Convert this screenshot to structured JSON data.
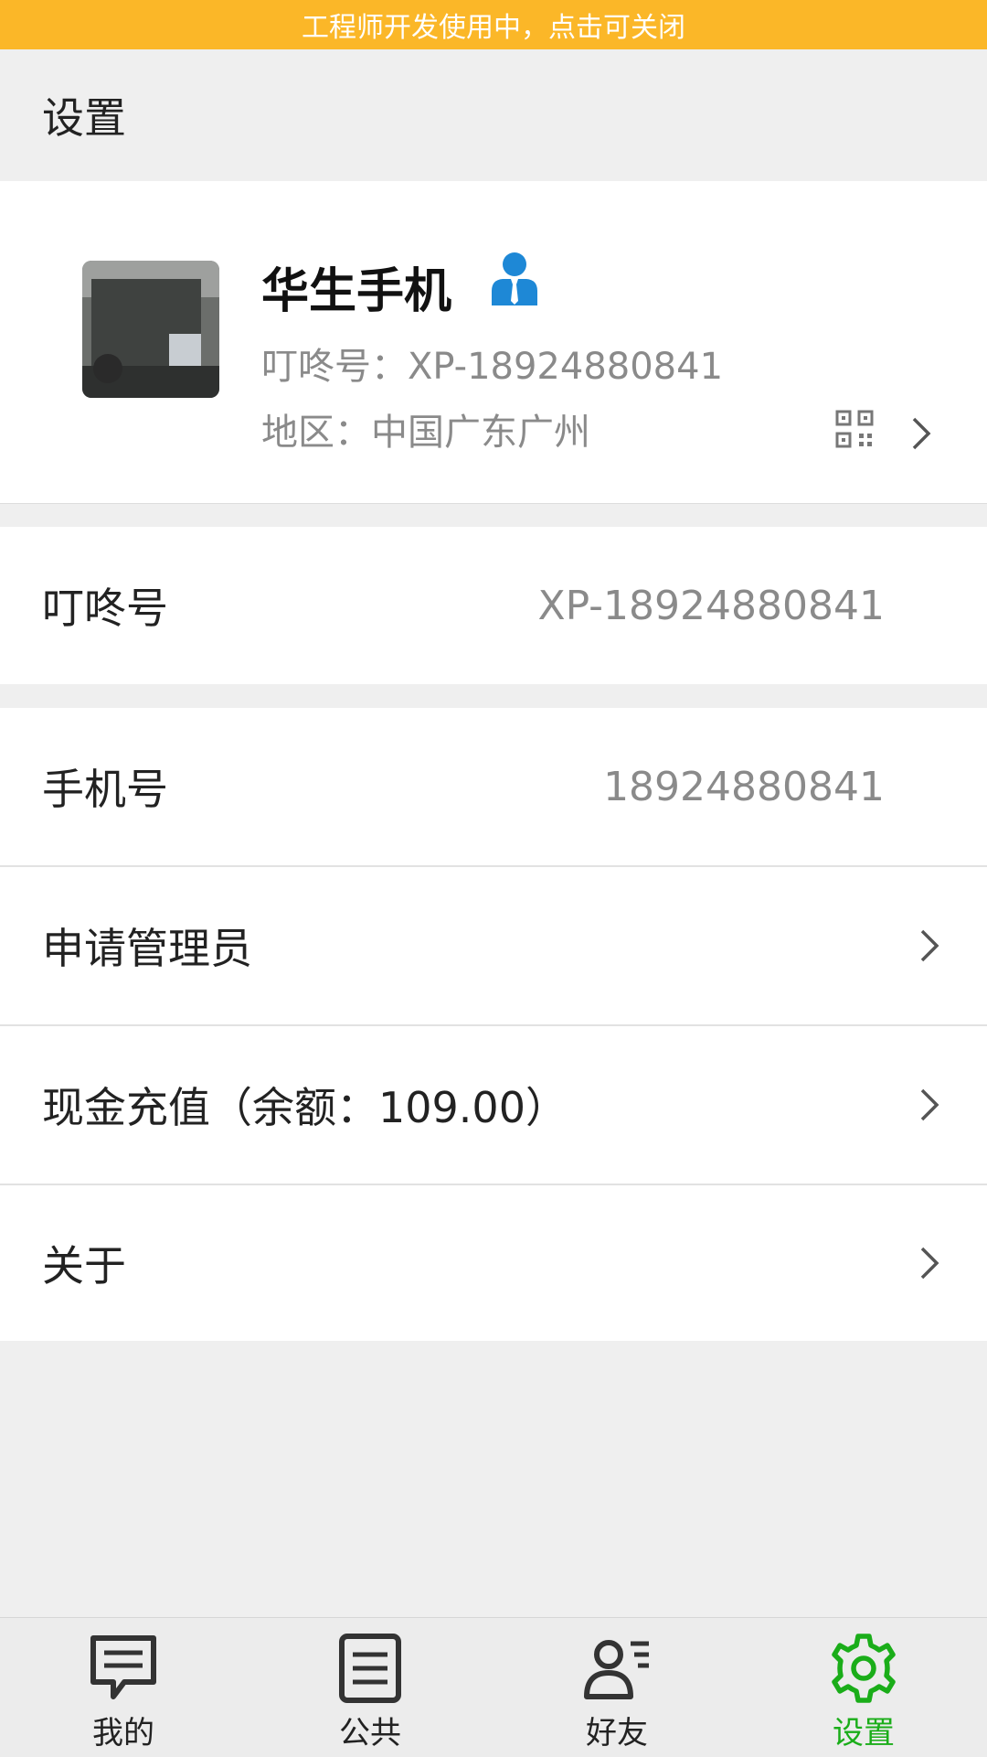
{
  "dev_banner": {
    "text": "工程师开发使用中，点击可关闭"
  },
  "header": {
    "title": "设置"
  },
  "profile": {
    "name": "华生手机",
    "dingdong_line": "叮咚号：XP-18924880841",
    "region_line": "地区：中国广东广州",
    "admin_icon": "admin-user-icon",
    "qr_icon": "qr-code-icon"
  },
  "rows": [
    {
      "label": "叮咚号",
      "value": "XP-18924880841"
    },
    {
      "label": "手机号",
      "value": "18924880841"
    },
    {
      "label": "申请管理员"
    },
    {
      "label": "现金充值（余额：109.00）"
    },
    {
      "label": "关于"
    }
  ],
  "tabs": [
    {
      "label": "我的",
      "icon": "chat-icon",
      "active": false
    },
    {
      "label": "公共",
      "icon": "list-icon",
      "active": false
    },
    {
      "label": "好友",
      "icon": "contacts-icon",
      "active": false
    },
    {
      "label": "设置",
      "icon": "gear-icon",
      "active": true
    }
  ],
  "colors": {
    "banner": "#fbb728",
    "accent_green": "#1aad19",
    "admin_blue": "#1e88d6"
  }
}
